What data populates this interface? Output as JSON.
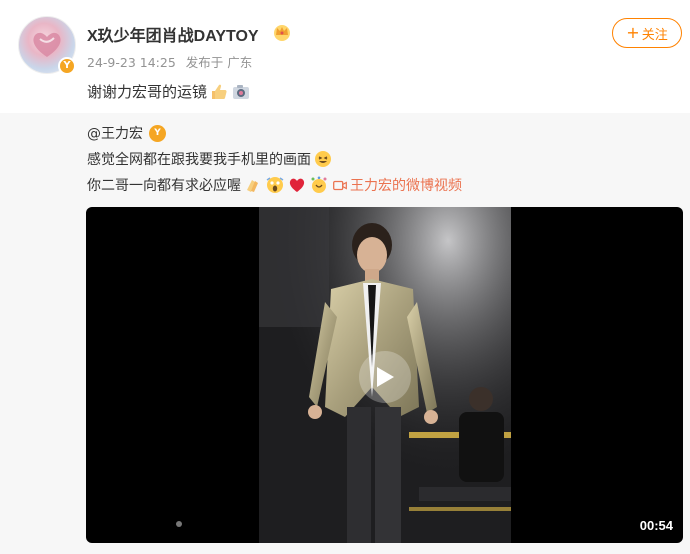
{
  "post": {
    "username": "X玖少年团肖战DAYTOY",
    "timestamp": "24-9-23 14:25",
    "source": "发布于 广东",
    "follow_label": "关注",
    "follow_plus": "+",
    "text": "谢谢力宏哥的运镜",
    "emojis": [
      "thumbs-up-emoji",
      "camera-emoji"
    ],
    "badge": "Y"
  },
  "repost": {
    "author": "@王力宏",
    "badge": "Y",
    "line1": "感觉全网都在跟我要我手机里的画面",
    "line2": "你二哥一向都有求必应喔",
    "video_link_label": "王力宏的微博视频"
  },
  "video": {
    "duration": "00:54"
  },
  "colors": {
    "accent": "#ff8200",
    "link": "#eb7350",
    "badge": "#f5a623"
  }
}
